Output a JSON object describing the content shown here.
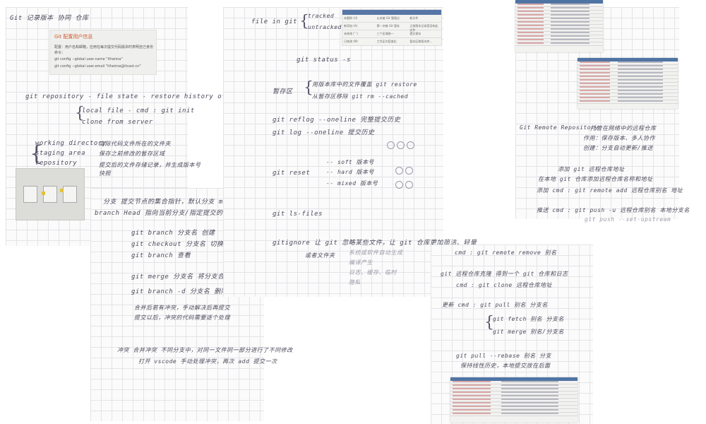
{
  "card": {
    "title": "Git 配置用户信息",
    "line1": "配置：用户名和邮箱，应用在每次提交代码版本时表明自己身份",
    "line2": "命令：",
    "line3": "git config --global user.name \"itheima\"",
    "line4": "git config --global user.email \"itheima@itcast.cn\""
  },
  "sheet1": {
    "top": "Git    记录版本   协同    仓库",
    "l1": "git  repository - file state  -  restore history of modification",
    "l2": "local  file  -  cmd :  git  init",
    "l3": "clone  from  server",
    "wd": "working  directory",
    "sa": "staging  area",
    "rp": "repository",
    "d1": "实际代码文件所在的文件夹",
    "d2": "保存之前修改的暂存区域",
    "d3": "提交后的文件存储记录，并生成版本号",
    "d4": "快照"
  },
  "branch": {
    "b1": "分支   提交节点的集合指针，默认分支 master",
    "b2": "branch   Head  指向当前分支/指定提交的指针",
    "c1": "git  branch  分支名        创建",
    "c2": "git  checkout  分支名       切换",
    "c3": "git  branch                查看",
    "c4": "git  merge  分支名    将分支合并到当前分支",
    "c5": "git  branch  -d  分支名   删除...",
    "n1": "合并后若有冲突，手动解决后再提交",
    "n2": "提交以后，冲突的代码需要逐个处理",
    "n3": "冲突  合并冲突    不同分支中，对同一文件同一部分进行了不同修改",
    "n4": "打开 vscode 手动处理冲突，再次 add 提交一次"
  },
  "sheet2": {
    "f1": "file  in  git",
    "f2": "tracked",
    "f3": "untracked",
    "s1": "git  status  -s",
    "z1": "暂存区",
    "z2": "用版本库中的文件覆盖  git  restore",
    "z3": "从暂存区移除   git  rm  --cached",
    "r1": "git  reflog  --oneline    完整提交历史",
    "r2": "git  log  --oneline      提交历史",
    "rs": "git  reset",
    "o1": "-- soft    版本号",
    "o2": "-- hard    版本号",
    "o3": "-- mixed   版本号",
    "ls": "git  ls-files",
    "gi": "gitignore  让 git 忽略某些文件，让 git 仓库更加简洁、轻量",
    "gi2": "或者文件夹",
    "g3": "系统或软件自动生成",
    "g4": "编译产生",
    "g5": "日志、缓存、临时",
    "g6": "隐私"
  },
  "sheet3": {
    "t1": "Git  Remote  Repository",
    "t2": "托管在网络中的远程仓库",
    "t3": "作用：保存版本、多人协作",
    "t4": "创建：分支自动更新/推送",
    "t5": "添加 git 远程仓库地址",
    "t6": "在本地 git 仓库添加远程仓库名称和地址",
    "t7": "添加 cmd :   git  remote  add  远程仓库别名  地址",
    "t8": "推送  cmd :   git  push  -u  远程仓库别名  本地分支名",
    "t9": "git push  --set-upstream",
    "u1": "cmd :   git  remote  remove  别名",
    "u2": "git 远程仓库克隆   得到一个 git 仓库和日志",
    "u3": "cmd :   git  clone  远程仓库地址",
    "u4": "更新  cmd :   git  pull  别名  分支名",
    "u5": "git  fetch  别名  分支名",
    "u6": "git  merge  别名/分支名",
    "u7": "git  pull  --rebase  别名   分支",
    "u8": "保持线性历史，本地提交放在后面"
  },
  "gtable": {
    "r1": [
      "未跟踪 (U)",
      "从未被 Git 管理过",
      "新文件"
    ],
    "r2": [
      "新添加 (A)",
      "第一次被 Git 暂存",
      "之前版本记录里没有此文件"
    ],
    "r3": [
      "未修改 (' ')",
      "三个区域统一",
      "提交保存"
    ],
    "r4": [
      "已修改 (M)",
      "工作区内容变化",
      "暂存区和版本库..."
    ]
  }
}
